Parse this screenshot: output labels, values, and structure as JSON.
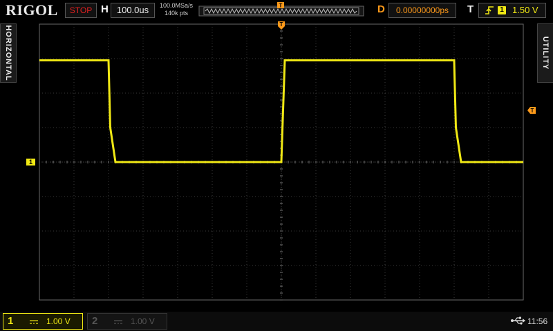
{
  "header": {
    "brand": "RIGOL",
    "run_state": "STOP",
    "horizontal_label": "H",
    "timebase": "100.0us",
    "sample_rate": "100.0MSa/s",
    "memory_depth": "140k pts",
    "delay_label": "D",
    "delay_value": "0.00000000ps",
    "trigger_label": "T",
    "trigger_source": "1",
    "trigger_level": "1.50 V"
  },
  "side_tabs": {
    "left": "HORIZONTAL",
    "right": "UTILITY"
  },
  "markers": {
    "ch1_ground": "1",
    "trigger_pos": "T",
    "trigger_level": "T"
  },
  "channels": [
    {
      "number": "1",
      "scale": "1.00 V",
      "active": true
    },
    {
      "number": "2",
      "scale": "1.00 V",
      "active": false
    }
  ],
  "status": {
    "time": "11:56"
  },
  "colors": {
    "ch1": "#f0e814",
    "trigger": "#ff9a1a",
    "stop": "#e02020",
    "grid": "#3a3a3a"
  },
  "chart_data": {
    "type": "line",
    "title": "",
    "xlabel": "",
    "ylabel": "",
    "grid": true,
    "x_divisions": 14,
    "y_divisions": 8,
    "xlim": [
      -700,
      700
    ],
    "ylim": [
      -4,
      4
    ],
    "series": [
      {
        "x": [
          -700,
          -500,
          -495,
          -480,
          0,
          5,
          10,
          500,
          505,
          520,
          700
        ],
        "y": [
          2.95,
          2.95,
          1.0,
          0.0,
          0.0,
          1.5,
          2.95,
          2.95,
          1.0,
          0.0,
          0.0
        ]
      }
    ]
  }
}
